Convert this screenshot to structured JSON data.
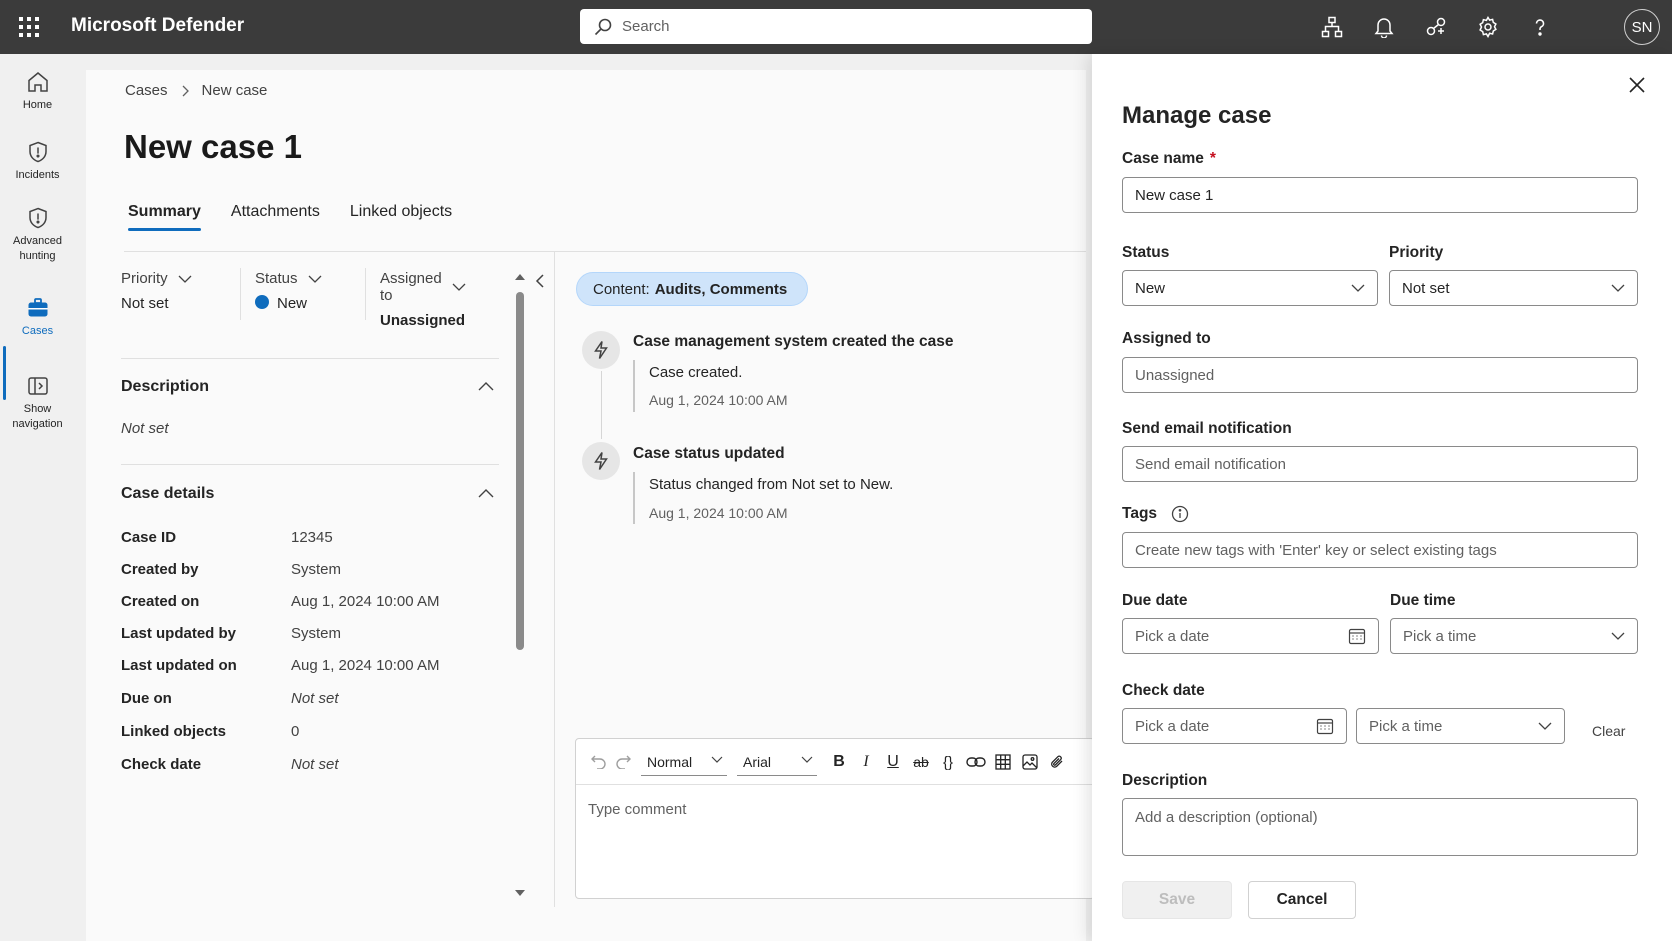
{
  "topbar": {
    "title": "Microsoft Defender",
    "search_placeholder": "Search",
    "avatar_initials": "SN",
    "icons": [
      "waffle-icon",
      "org-chart-icon",
      "bell-icon",
      "share-icon",
      "gear-icon",
      "help-icon"
    ]
  },
  "rail": {
    "items": [
      {
        "label": "Home",
        "icon": "home-icon"
      },
      {
        "label": "Incidents",
        "icon": "shield-icon"
      },
      {
        "label": "Advanced hunting",
        "icon": "shield-icon"
      },
      {
        "label": "Cases",
        "icon": "briefcase-icon"
      },
      {
        "label": "Show navigation",
        "icon": "nav-panel-icon"
      }
    ],
    "active": "Cases"
  },
  "breadcrumb": [
    "Cases",
    "New case"
  ],
  "page": {
    "title": "New case 1",
    "tabs": [
      "Summary",
      "Attachments",
      "Linked objects"
    ],
    "active_tab": "Summary"
  },
  "summary": {
    "priority_label": "Priority",
    "priority_value": "Not set",
    "status_label": "Status",
    "status_value": "New",
    "assigned_label": "Assigned to",
    "assigned_value": "Unassigned",
    "description_heading": "Description",
    "description_value": "Not set",
    "details_heading": "Case details",
    "details": [
      {
        "key": "Case ID",
        "value": "12345"
      },
      {
        "key": "Created by",
        "value": "System"
      },
      {
        "key": "Created on",
        "value": "Aug 1, 2024 10:00 AM"
      },
      {
        "key": "Last updated by",
        "value": "System"
      },
      {
        "key": "Last updated on",
        "value": "Aug 1, 2024 10:00 AM"
      },
      {
        "key": "Due on",
        "value": "Not set"
      },
      {
        "key": "Linked objects",
        "value": "0"
      },
      {
        "key": "Check date",
        "value": "Not set"
      }
    ]
  },
  "activity": {
    "filter_prefix": "Content:",
    "filter_value": "Audits, Comments",
    "events": [
      {
        "title": "Case management system created the case",
        "text": "Case created.",
        "time": "Aug 1, 2024 10:00 AM"
      },
      {
        "title": "Case status updated",
        "text": "Status changed from Not set to New.",
        "time": "Aug 1, 2024 10:00 AM"
      }
    ]
  },
  "editor": {
    "style_select": "Normal",
    "font_select": "Arial",
    "placeholder": "Type comment"
  },
  "panel": {
    "title": "Manage case",
    "case_name_label": "Case name",
    "required_mark": "*",
    "case_name_value": "New case 1",
    "status_label": "Status",
    "status_value": "New",
    "priority_label": "Priority",
    "priority_value": "Not set",
    "assigned_label": "Assigned to",
    "assigned_placeholder": "Unassigned",
    "email_label": "Send email notification",
    "email_placeholder": "Send email notification",
    "tags_label": "Tags",
    "tags_placeholder": "Create new tags with 'Enter' key or select existing tags",
    "due_date_label": "Due date",
    "due_date_placeholder": "Pick a date",
    "due_time_label": "Due time",
    "due_time_placeholder": "Pick a time",
    "check_date_label": "Check date",
    "check_date_placeholder": "Pick a date",
    "check_time_placeholder": "Pick a time",
    "clear_label": "Clear",
    "description_label": "Description",
    "description_placeholder": "Add a description (optional)",
    "save_label": "Save",
    "cancel_label": "Cancel"
  },
  "colors": {
    "topbar_bg": "#3b3b3b",
    "accent": "#0f6cbd",
    "pill_bg": "#cfe4fa",
    "required": "#c50f1f"
  }
}
